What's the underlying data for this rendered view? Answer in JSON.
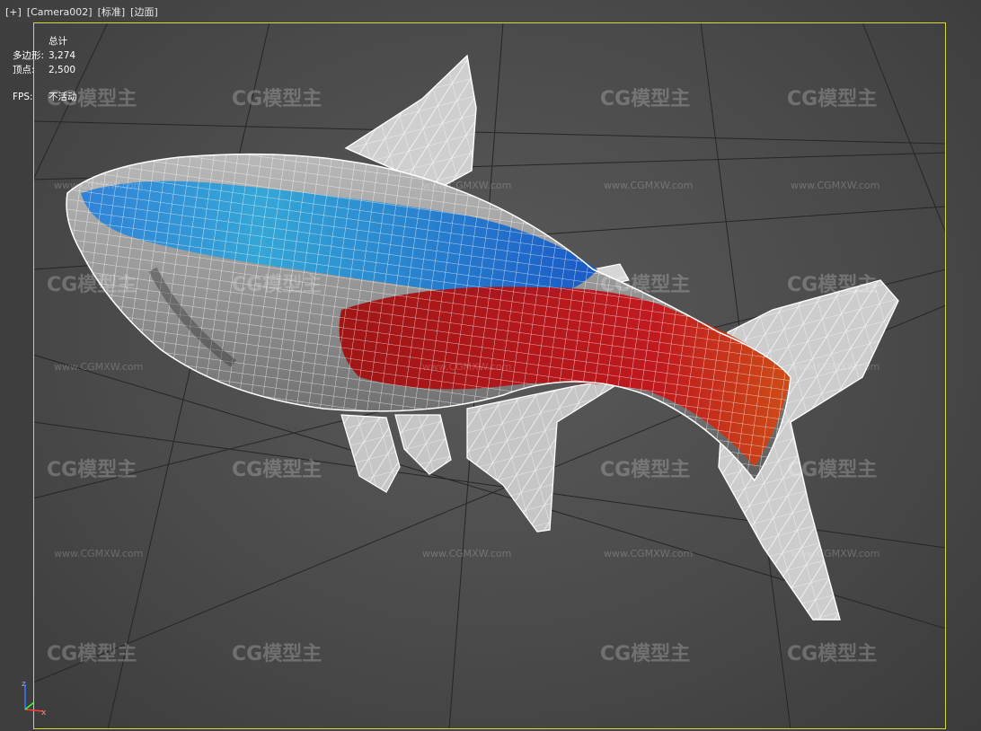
{
  "viewport_menu": {
    "plus": "[+]",
    "camera": "[Camera002]",
    "shading_standard": "[标准]",
    "shading_edges": "[边面]"
  },
  "stats": {
    "header": "总计",
    "polygons_label": "多边形:",
    "polygons_value": "3,274",
    "vertices_label": "顶点:",
    "vertices_value": "2,500",
    "fps_label": "FPS:",
    "fps_value": "不活动"
  },
  "watermark": {
    "logo_text": "CG模型主",
    "url_text": "www.CGMXW.com"
  },
  "axis_gizmo": {
    "z_label": "z",
    "x_label": "x"
  },
  "colors": {
    "viewport_border": "#d8d83a",
    "grid_line": "#2a2a2a",
    "wire": "#ffffff",
    "fish_blue": "#1f6fd6",
    "fish_red": "#b3141a",
    "fish_body": "#8a8a8a"
  }
}
